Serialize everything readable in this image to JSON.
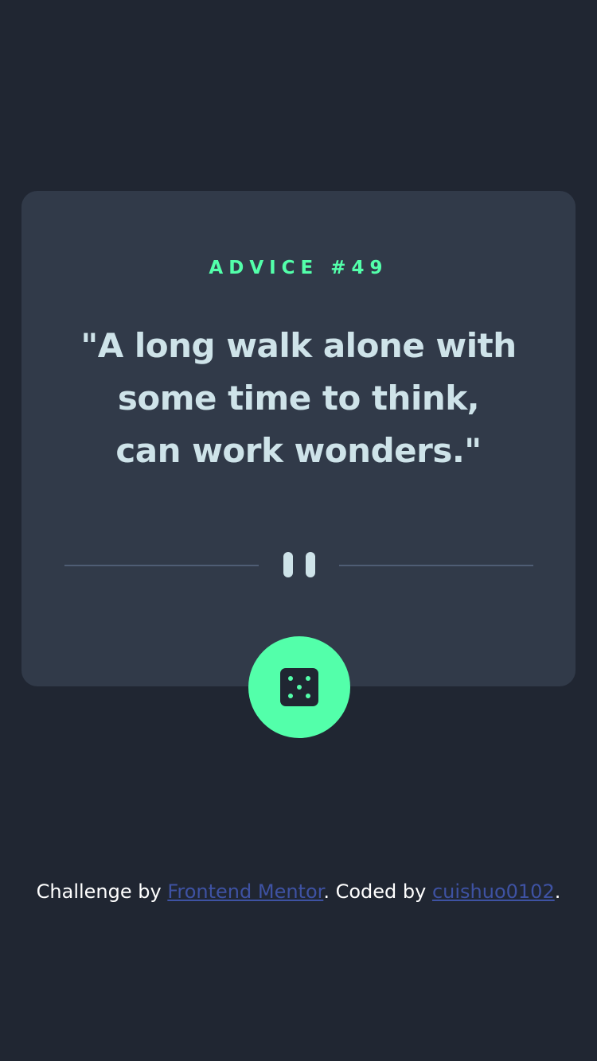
{
  "advice": {
    "label": "ADVICE #49",
    "quote_lines": [
      "\"A long walk alone with",
      "some time to think,",
      "can work wonders.\""
    ]
  },
  "divider": {
    "icon": "pause-icon"
  },
  "dice_button": {
    "icon": "dice-icon"
  },
  "attribution": {
    "prefix": "Challenge by ",
    "challenge_link": "Frontend Mentor",
    "middle": ". Coded by ",
    "author_link": "cuishuo0102",
    "suffix": "."
  },
  "colors": {
    "background": "#202632",
    "card": "#313a49",
    "accent": "#53ffaa",
    "quote_text": "#cee3e9",
    "divider": "#4f5d74",
    "link": "#3e52a3"
  }
}
